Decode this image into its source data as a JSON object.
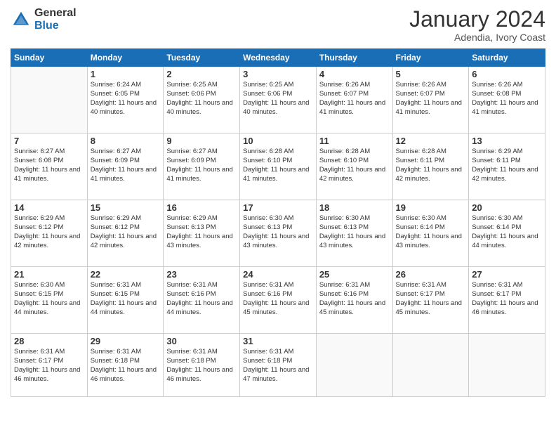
{
  "header": {
    "logo_general": "General",
    "logo_blue": "Blue",
    "month_title": "January 2024",
    "location": "Adendia, Ivory Coast"
  },
  "days_of_week": [
    "Sunday",
    "Monday",
    "Tuesday",
    "Wednesday",
    "Thursday",
    "Friday",
    "Saturday"
  ],
  "weeks": [
    [
      {
        "day": "",
        "sunrise": "",
        "sunset": "",
        "daylight": ""
      },
      {
        "day": "1",
        "sunrise": "Sunrise: 6:24 AM",
        "sunset": "Sunset: 6:05 PM",
        "daylight": "Daylight: 11 hours and 40 minutes."
      },
      {
        "day": "2",
        "sunrise": "Sunrise: 6:25 AM",
        "sunset": "Sunset: 6:06 PM",
        "daylight": "Daylight: 11 hours and 40 minutes."
      },
      {
        "day": "3",
        "sunrise": "Sunrise: 6:25 AM",
        "sunset": "Sunset: 6:06 PM",
        "daylight": "Daylight: 11 hours and 40 minutes."
      },
      {
        "day": "4",
        "sunrise": "Sunrise: 6:26 AM",
        "sunset": "Sunset: 6:07 PM",
        "daylight": "Daylight: 11 hours and 41 minutes."
      },
      {
        "day": "5",
        "sunrise": "Sunrise: 6:26 AM",
        "sunset": "Sunset: 6:07 PM",
        "daylight": "Daylight: 11 hours and 41 minutes."
      },
      {
        "day": "6",
        "sunrise": "Sunrise: 6:26 AM",
        "sunset": "Sunset: 6:08 PM",
        "daylight": "Daylight: 11 hours and 41 minutes."
      }
    ],
    [
      {
        "day": "7",
        "sunrise": "Sunrise: 6:27 AM",
        "sunset": "Sunset: 6:08 PM",
        "daylight": "Daylight: 11 hours and 41 minutes."
      },
      {
        "day": "8",
        "sunrise": "Sunrise: 6:27 AM",
        "sunset": "Sunset: 6:09 PM",
        "daylight": "Daylight: 11 hours and 41 minutes."
      },
      {
        "day": "9",
        "sunrise": "Sunrise: 6:27 AM",
        "sunset": "Sunset: 6:09 PM",
        "daylight": "Daylight: 11 hours and 41 minutes."
      },
      {
        "day": "10",
        "sunrise": "Sunrise: 6:28 AM",
        "sunset": "Sunset: 6:10 PM",
        "daylight": "Daylight: 11 hours and 41 minutes."
      },
      {
        "day": "11",
        "sunrise": "Sunrise: 6:28 AM",
        "sunset": "Sunset: 6:10 PM",
        "daylight": "Daylight: 11 hours and 42 minutes."
      },
      {
        "day": "12",
        "sunrise": "Sunrise: 6:28 AM",
        "sunset": "Sunset: 6:11 PM",
        "daylight": "Daylight: 11 hours and 42 minutes."
      },
      {
        "day": "13",
        "sunrise": "Sunrise: 6:29 AM",
        "sunset": "Sunset: 6:11 PM",
        "daylight": "Daylight: 11 hours and 42 minutes."
      }
    ],
    [
      {
        "day": "14",
        "sunrise": "Sunrise: 6:29 AM",
        "sunset": "Sunset: 6:12 PM",
        "daylight": "Daylight: 11 hours and 42 minutes."
      },
      {
        "day": "15",
        "sunrise": "Sunrise: 6:29 AM",
        "sunset": "Sunset: 6:12 PM",
        "daylight": "Daylight: 11 hours and 42 minutes."
      },
      {
        "day": "16",
        "sunrise": "Sunrise: 6:29 AM",
        "sunset": "Sunset: 6:13 PM",
        "daylight": "Daylight: 11 hours and 43 minutes."
      },
      {
        "day": "17",
        "sunrise": "Sunrise: 6:30 AM",
        "sunset": "Sunset: 6:13 PM",
        "daylight": "Daylight: 11 hours and 43 minutes."
      },
      {
        "day": "18",
        "sunrise": "Sunrise: 6:30 AM",
        "sunset": "Sunset: 6:13 PM",
        "daylight": "Daylight: 11 hours and 43 minutes."
      },
      {
        "day": "19",
        "sunrise": "Sunrise: 6:30 AM",
        "sunset": "Sunset: 6:14 PM",
        "daylight": "Daylight: 11 hours and 43 minutes."
      },
      {
        "day": "20",
        "sunrise": "Sunrise: 6:30 AM",
        "sunset": "Sunset: 6:14 PM",
        "daylight": "Daylight: 11 hours and 44 minutes."
      }
    ],
    [
      {
        "day": "21",
        "sunrise": "Sunrise: 6:30 AM",
        "sunset": "Sunset: 6:15 PM",
        "daylight": "Daylight: 11 hours and 44 minutes."
      },
      {
        "day": "22",
        "sunrise": "Sunrise: 6:31 AM",
        "sunset": "Sunset: 6:15 PM",
        "daylight": "Daylight: 11 hours and 44 minutes."
      },
      {
        "day": "23",
        "sunrise": "Sunrise: 6:31 AM",
        "sunset": "Sunset: 6:16 PM",
        "daylight": "Daylight: 11 hours and 44 minutes."
      },
      {
        "day": "24",
        "sunrise": "Sunrise: 6:31 AM",
        "sunset": "Sunset: 6:16 PM",
        "daylight": "Daylight: 11 hours and 45 minutes."
      },
      {
        "day": "25",
        "sunrise": "Sunrise: 6:31 AM",
        "sunset": "Sunset: 6:16 PM",
        "daylight": "Daylight: 11 hours and 45 minutes."
      },
      {
        "day": "26",
        "sunrise": "Sunrise: 6:31 AM",
        "sunset": "Sunset: 6:17 PM",
        "daylight": "Daylight: 11 hours and 45 minutes."
      },
      {
        "day": "27",
        "sunrise": "Sunrise: 6:31 AM",
        "sunset": "Sunset: 6:17 PM",
        "daylight": "Daylight: 11 hours and 46 minutes."
      }
    ],
    [
      {
        "day": "28",
        "sunrise": "Sunrise: 6:31 AM",
        "sunset": "Sunset: 6:17 PM",
        "daylight": "Daylight: 11 hours and 46 minutes."
      },
      {
        "day": "29",
        "sunrise": "Sunrise: 6:31 AM",
        "sunset": "Sunset: 6:18 PM",
        "daylight": "Daylight: 11 hours and 46 minutes."
      },
      {
        "day": "30",
        "sunrise": "Sunrise: 6:31 AM",
        "sunset": "Sunset: 6:18 PM",
        "daylight": "Daylight: 11 hours and 46 minutes."
      },
      {
        "day": "31",
        "sunrise": "Sunrise: 6:31 AM",
        "sunset": "Sunset: 6:18 PM",
        "daylight": "Daylight: 11 hours and 47 minutes."
      },
      {
        "day": "",
        "sunrise": "",
        "sunset": "",
        "daylight": ""
      },
      {
        "day": "",
        "sunrise": "",
        "sunset": "",
        "daylight": ""
      },
      {
        "day": "",
        "sunrise": "",
        "sunset": "",
        "daylight": ""
      }
    ]
  ]
}
